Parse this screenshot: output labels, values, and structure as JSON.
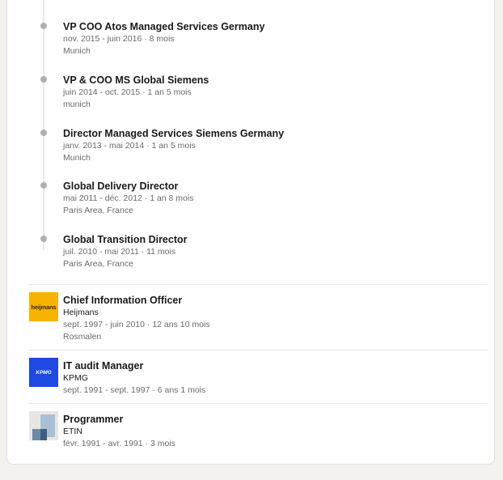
{
  "roles": [
    {
      "title": "VP COO Atos Managed Services Germany",
      "dates": "nov. 2015 - juin 2016 · 8 mois",
      "location": "Munich"
    },
    {
      "title": "VP & COO MS Global Siemens",
      "dates": "juin 2014 - oct. 2015 · 1 an 5 mois",
      "location": "munich"
    },
    {
      "title": "Director Managed Services Siemens Germany",
      "dates": "janv. 2013 - mai 2014 · 1 an 5 mois",
      "location": "Munich"
    },
    {
      "title": "Global Delivery Director",
      "dates": "mai 2011 - déc. 2012 · 1 an 8 mois",
      "location": "Paris Area, France"
    },
    {
      "title": "Global Transition Director",
      "dates": "juil. 2010 - mai 2011 · 11 mois",
      "location": "Paris Area, France"
    }
  ],
  "experiences": [
    {
      "title": "Chief Information Officer",
      "company": "Heijmans",
      "dates": "sept. 1997 - juin 2010 · 12 ans 10 mois",
      "location": "Rosmalen",
      "logo_text": "heijmans",
      "logo_color": "#f6b300"
    },
    {
      "title": "IT audit Manager",
      "company": "KPMG",
      "dates": "sept. 1991 - sept. 1997 · 6 ans 1 mois",
      "logo_text": "KPMG",
      "logo_color": "#1e49e2"
    },
    {
      "title": "Programmer",
      "company": "ETIN",
      "dates": "févr. 1991 - avr. 1991 · 3 mois"
    }
  ]
}
